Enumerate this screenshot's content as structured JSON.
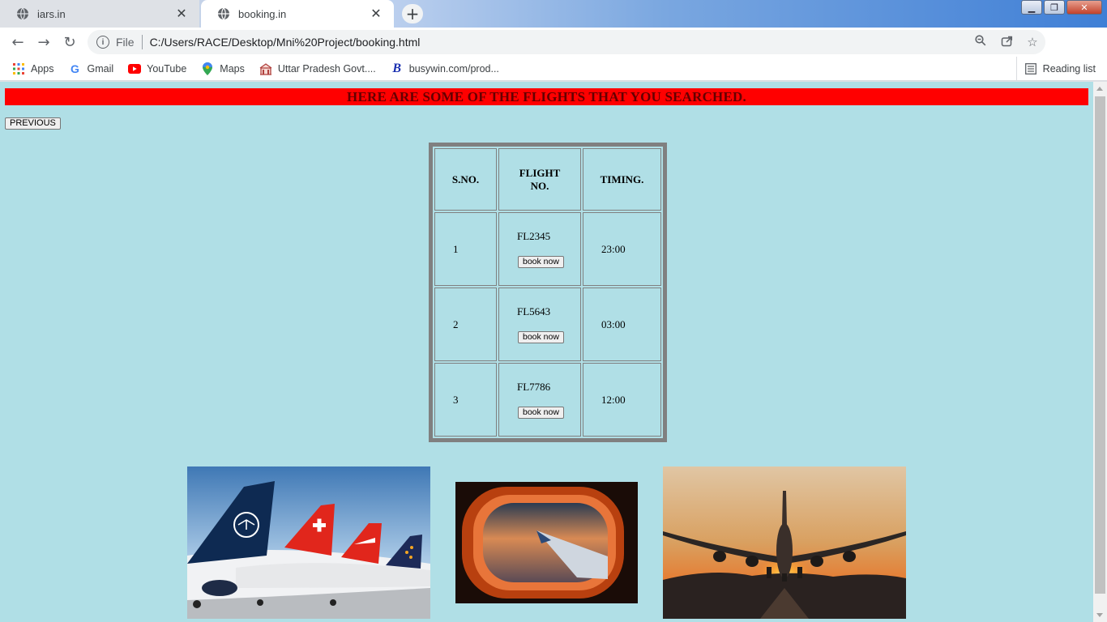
{
  "browser": {
    "tabs": [
      {
        "title": "iars.in",
        "active": false
      },
      {
        "title": "booking.in",
        "active": true
      }
    ],
    "address": {
      "scheme": "File",
      "url": "C:/Users/RACE/Desktop/Mni%20Project/booking.html"
    },
    "bookmarks": [
      {
        "label": "Apps",
        "icon": "apps-grid-icon"
      },
      {
        "label": "Gmail",
        "icon": "google-icon"
      },
      {
        "label": "YouTube",
        "icon": "youtube-icon"
      },
      {
        "label": "Maps",
        "icon": "maps-pin-icon"
      },
      {
        "label": "Uttar Pradesh Govt....",
        "icon": "building-icon"
      },
      {
        "label": "busywin.com/prod...",
        "icon": "busy-b-icon"
      }
    ],
    "reading_list": "Reading list"
  },
  "page": {
    "banner": "HERE ARE SOME OF THE FLIGHTS THAT YOU SEARCHED.",
    "previous_label": "PREVIOUS",
    "table": {
      "headers": {
        "sno": "S.NO.",
        "flight_line1": "FLIGHT",
        "flight_line2": "NO.",
        "timing": "TIMING."
      },
      "rows": [
        {
          "sno": "1",
          "flight": "FL2345",
          "button": "book now",
          "timing": "23:00"
        },
        {
          "sno": "2",
          "flight": "FL5643",
          "button": "book now",
          "timing": "03:00"
        },
        {
          "sno": "3",
          "flight": "FL7786",
          "button": "book now",
          "timing": "12:00"
        }
      ]
    },
    "images": [
      "airline-tails-photo",
      "plane-window-sunset-photo",
      "plane-landing-sunset-photo"
    ]
  },
  "colors": {
    "page_bg": "#b0dfe6",
    "banner_bg": "#ff0000",
    "banner_text": "#660000"
  }
}
